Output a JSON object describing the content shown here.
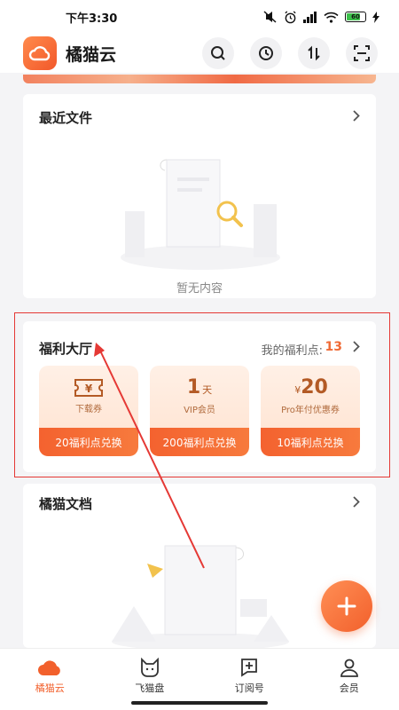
{
  "status_bar": {
    "time": "下午3:30",
    "battery": "60"
  },
  "header": {
    "title": "橘猫云"
  },
  "recent": {
    "title": "最近文件",
    "empty_text": "暂无内容"
  },
  "welfare": {
    "title": "福利大厅",
    "points_label": "我的福利点:",
    "points_value": "13",
    "coupons": [
      {
        "sub": "下载券",
        "button": "20福利点兑换"
      },
      {
        "num": "1",
        "unit": "天",
        "sub": "VIP会员",
        "button": "200福利点兑换"
      },
      {
        "currency": "¥",
        "num": "20",
        "sub": "Pro年付优惠券",
        "button": "10福利点兑换"
      }
    ]
  },
  "docs": {
    "title": "橘猫文档"
  },
  "nav": [
    {
      "label": "橘猫云",
      "active": true
    },
    {
      "label": "飞猫盘"
    },
    {
      "label": "订阅号"
    },
    {
      "label": "会员"
    }
  ],
  "colors": {
    "accent": "#f2602c",
    "annotation": "#e53935"
  }
}
